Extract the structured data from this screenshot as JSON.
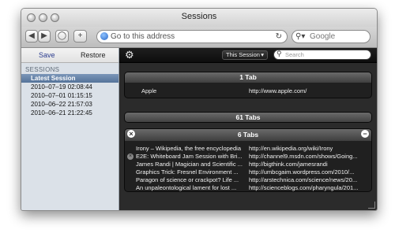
{
  "window": {
    "title": "Sessions"
  },
  "toolbar": {
    "back_icon": "back-arrow-icon",
    "forward_icon": "forward-arrow-icon",
    "stop_label": "◯",
    "add_label": "+",
    "address_placeholder": "Go to this address",
    "reload_label": "↻",
    "search_placeholder": "Google"
  },
  "sidebar": {
    "save_label": "Save",
    "restore_label": "Restore",
    "section_title": "SESSIONS",
    "items": [
      {
        "label": "Latest Session",
        "selected": true
      },
      {
        "label": "2010–07–19 02:08:44"
      },
      {
        "label": "2010–07–01 01:15:15"
      },
      {
        "label": "2010–06–22 21:57:03"
      },
      {
        "label": "2010–06–21 21:22:45"
      }
    ]
  },
  "main": {
    "session_select": "This Session",
    "search_placeholder": "Search",
    "groups": [
      {
        "title": "1 Tab",
        "tabs": [
          {
            "title": "Apple",
            "url": "http://www.apple.com/"
          }
        ]
      },
      {
        "title": "61 Tabs",
        "tabs": []
      },
      {
        "title": "6 Tabs",
        "tabs": [
          {
            "title": "Irony – Wikipedia, the free encyclopedia",
            "url": "http://en.wikipedia.org/wiki/Irony"
          },
          {
            "title": "E2E: Whiteboard Jam Session with Bri...",
            "url": "http://channel9.msdn.com/shows/Going..."
          },
          {
            "title": "James Randi | Magician and Scientific ...",
            "url": "http://bigthink.com/jamesrandi"
          },
          {
            "title": "Graphics Trick: Fresnel Environment ...",
            "url": "http://umbcgaim.wordpress.com/2010/..."
          },
          {
            "title": "Paragon of science or crackpot? Life ...",
            "url": "http://arstechnica.com/science/news/20..."
          },
          {
            "title": "An unpaleontological lament for lost ...",
            "url": "http://scienceblogs.com/pharyngula/201..."
          }
        ]
      }
    ]
  }
}
